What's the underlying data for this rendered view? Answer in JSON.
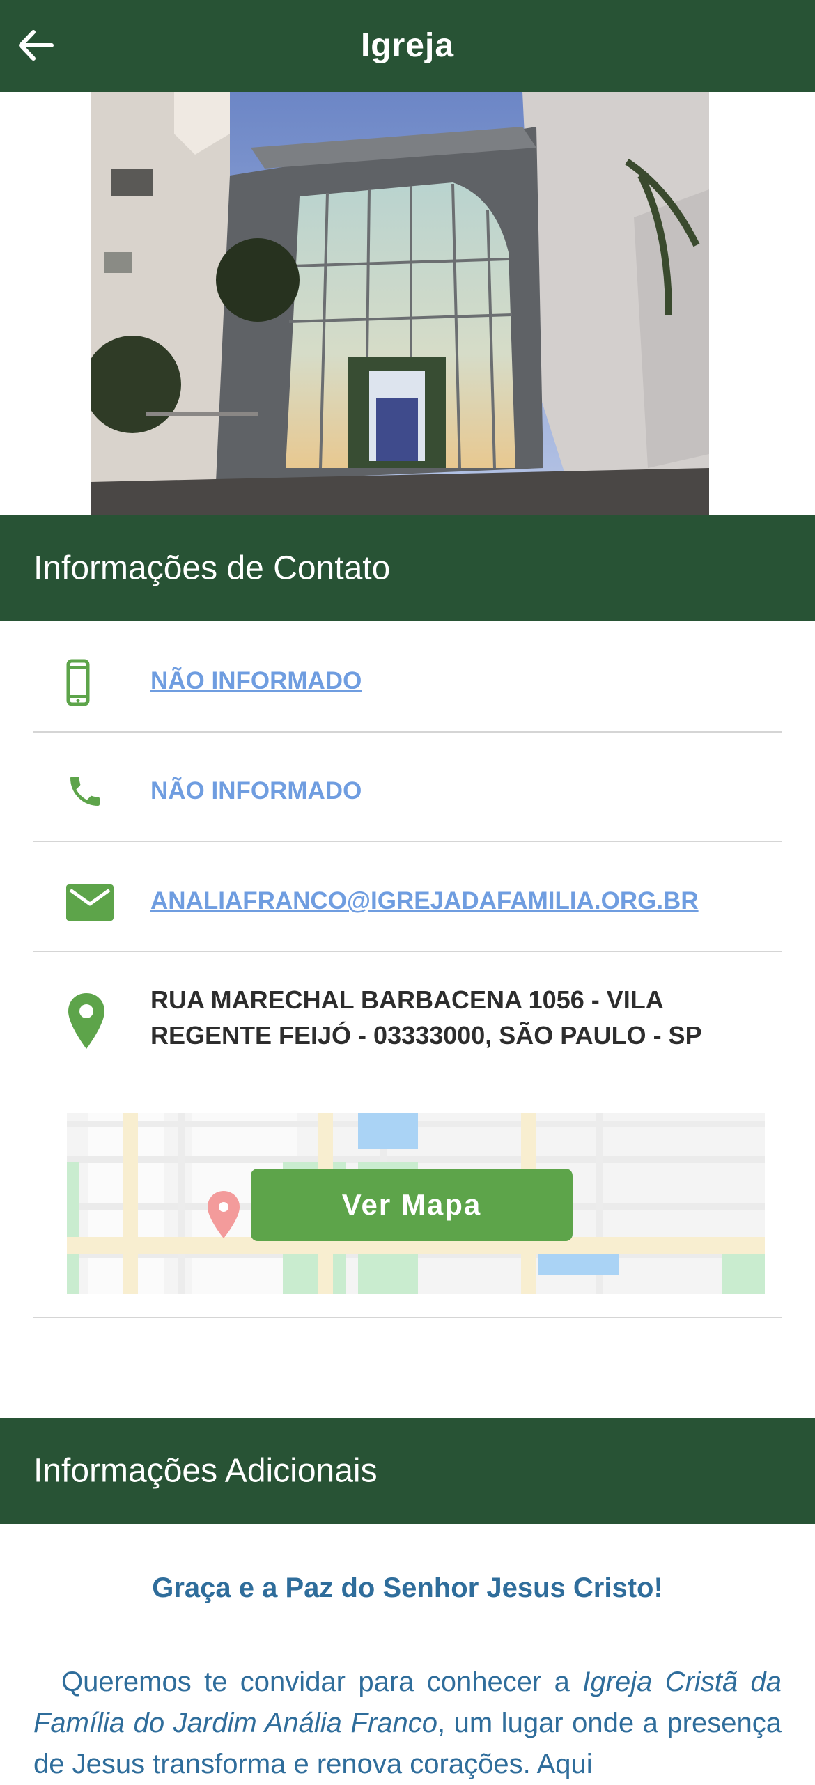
{
  "header": {
    "title": "Igreja"
  },
  "contact": {
    "section_title": "Informações de Contato",
    "mobile": "NÃO INFORMADO",
    "phone": "NÃO INFORMADO",
    "email": "ANALIAFRANCO@IGREJADAFAMILIA.ORG.BR",
    "address_line1": "RUA MARECHAL BARBACENA 1056 - VILA",
    "address_line2": "REGENTE FEIJÓ - 03333000, SÃO PAULO - SP",
    "map_button": "Ver Mapa"
  },
  "additional": {
    "section_title": "Informações Adicionais",
    "greeting": "Graça e a Paz do Senhor Jesus Cristo!",
    "para_start": "Queremos te convidar para conhecer a ",
    "church_name": "Igreja Cristã da Família do Jardim Anália Franco",
    "para_end": ", um lugar onde a presença de Jesus transforma e renova corações. Aqui"
  },
  "colors": {
    "header_bg": "#285335",
    "icon_green": "#5da44a",
    "link_blue": "#6f9de0",
    "text_blue": "#2f6d9b"
  },
  "icons": [
    "back-arrow-icon",
    "mobile-phone-icon",
    "phone-icon",
    "mail-icon",
    "location-pin-icon",
    "map-marker-icon"
  ]
}
